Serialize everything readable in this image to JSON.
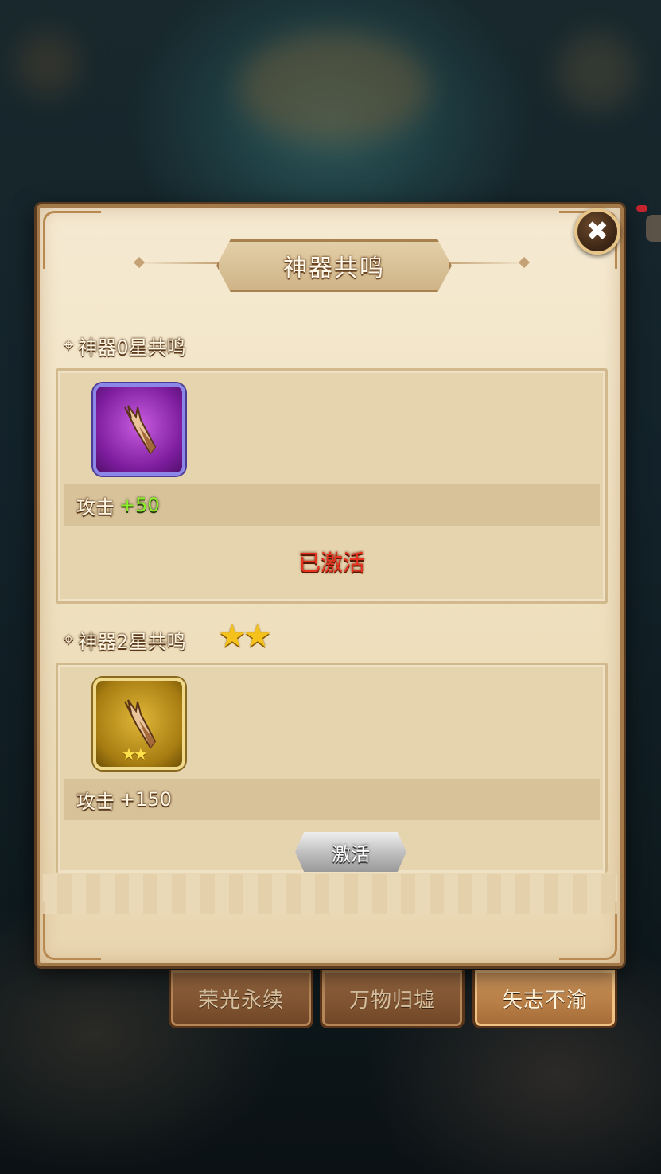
{
  "panel": {
    "title": "神器共鸣",
    "close_label": "✖"
  },
  "sections": [
    {
      "heading": "神器0星共鸣",
      "stars": 0,
      "icon": "claw-dagger-icon",
      "icon_color": "#9b2fc0",
      "stat_label": "攻击",
      "stat_value": "+50",
      "status": "已激活"
    },
    {
      "heading": "神器2星共鸣",
      "stars": 2,
      "stars_text": "★★",
      "icon": "claw-dagger-icon",
      "icon_color": "#c99a1e",
      "icon_stars_text": "★★",
      "stat_label": "攻击",
      "stat_value": "+150",
      "button": "激活"
    }
  ],
  "bottom_tabs": [
    {
      "label": "荣光永续",
      "active": false
    },
    {
      "label": "万物归墟",
      "active": false
    },
    {
      "label": "矢志不渝",
      "active": true
    }
  ],
  "colors": {
    "accent_green": "#8bf02a",
    "activated_red": "#e8321e",
    "star_gold": "#f4c21a"
  }
}
